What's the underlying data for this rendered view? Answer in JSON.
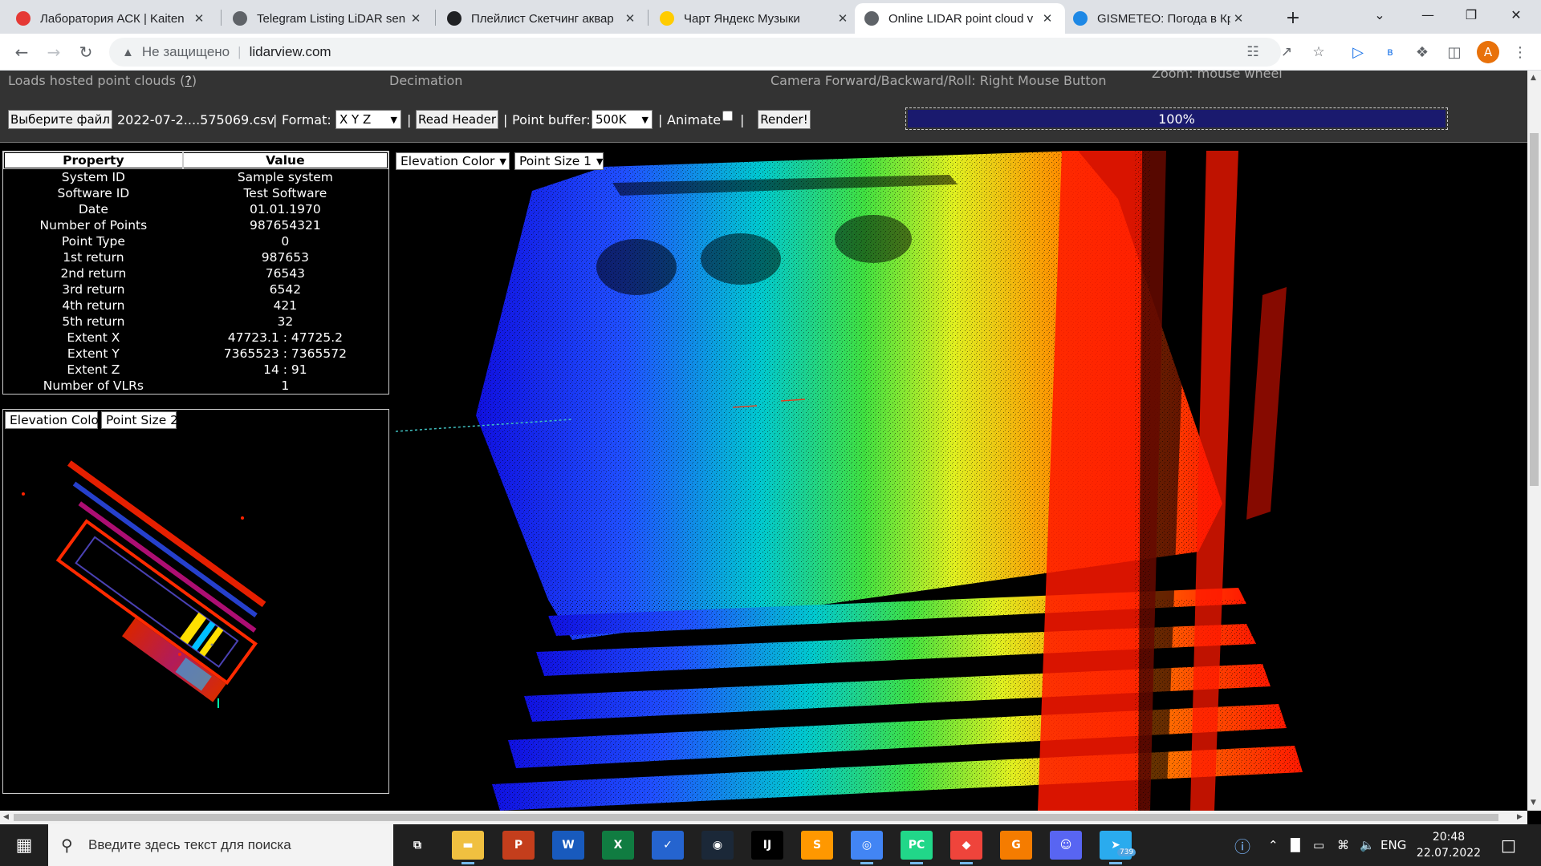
{
  "browser": {
    "tabs": [
      {
        "title": "Лаборатория АСК | Kaiten",
        "favicon": "kaiten-icon",
        "color": "#e53935",
        "active": false
      },
      {
        "title": "Telegram Listing LiDAR sen",
        "favicon": "globe-icon",
        "color": "#5f6368",
        "active": false
      },
      {
        "title": "Плейлист Скетчинг аквар",
        "favicon": "pause-icon",
        "color": "#202124",
        "active": false
      },
      {
        "title": "Чарт Яндекс Музыки",
        "favicon": "yandex-music-icon",
        "color": "#ffcc00",
        "active": false
      },
      {
        "title": "Online LIDAR point cloud v",
        "favicon": "globe-icon",
        "color": "#5f6368",
        "active": true
      },
      {
        "title": "GISMETEO: Погода в Крас",
        "favicon": "gismeteo-icon",
        "color": "#1e88e5",
        "active": false
      }
    ],
    "new_tab": "+",
    "address": {
      "security_label": "Не защищено",
      "url": "lidarview.com"
    },
    "profile_initial": "A",
    "extension_label": "в"
  },
  "page": {
    "help": {
      "loads_text": "Loads hosted point clouds (",
      "loads_link": "?",
      "loads_close": ")",
      "decimation": "Decimation",
      "camera": "Camera Forward/Backward/Roll: Right Mouse Button",
      "zoom": "Zoom: mouse wheel"
    },
    "controls": {
      "choose_file": "Выберите файл",
      "file_name": "2022-07-2....575069.csv",
      "sep": "|",
      "format_label": "Format:",
      "format_value": "X Y Z",
      "read_header": "Read Header",
      "point_buffer_label": "Point buffer:",
      "point_buffer_value": "500K",
      "animate_label": "Animate",
      "animate_checked": false,
      "render": "Render!",
      "progress_text": "100%",
      "progress_value": 1.0
    },
    "header_table": {
      "columns": [
        "Property",
        "Value"
      ],
      "rows": [
        [
          "System ID",
          "Sample system"
        ],
        [
          "Software ID",
          "Test Software"
        ],
        [
          "Date",
          "01.01.1970"
        ],
        [
          "Number of Points",
          "987654321"
        ],
        [
          "Point Type",
          "0"
        ],
        [
          "1st return",
          "987653"
        ],
        [
          "2nd return",
          "76543"
        ],
        [
          "3rd return",
          "6542"
        ],
        [
          "4th return",
          "421"
        ],
        [
          "5th return",
          "32"
        ],
        [
          "Extent X",
          "47723.1 : 47725.2"
        ],
        [
          "Extent Y",
          "7365523 : 7365572"
        ],
        [
          "Extent Z",
          "14 : 91"
        ],
        [
          "Number of VLRs",
          "1"
        ]
      ]
    },
    "main_view": {
      "color_mode": "Elevation Color",
      "point_size": "Point Size 1"
    },
    "mini_view": {
      "color_mode": "Elevation Color",
      "point_size": "Point Size 2"
    }
  },
  "taskbar": {
    "search_placeholder": "Введите здесь текст для поиска",
    "apps": [
      {
        "name": "task-view-icon",
        "label": "⧉",
        "color": "#202020"
      },
      {
        "name": "file-explorer-icon",
        "label": "▬",
        "color": "#f0c040"
      },
      {
        "name": "powerpoint-icon",
        "label": "P",
        "color": "#c43e1c"
      },
      {
        "name": "word-icon",
        "label": "W",
        "color": "#185abd"
      },
      {
        "name": "excel-icon",
        "label": "X",
        "color": "#107c41"
      },
      {
        "name": "todo-icon",
        "label": "✓",
        "color": "#2564cf"
      },
      {
        "name": "steam-icon",
        "label": "◉",
        "color": "#1b2838"
      },
      {
        "name": "intellij-icon",
        "label": "IJ",
        "color": "#000000"
      },
      {
        "name": "sublime-icon",
        "label": "S",
        "color": "#ff9800"
      },
      {
        "name": "chrome-icon",
        "label": "◎",
        "color": "#4285f4"
      },
      {
        "name": "pycharm-icon",
        "label": "PC",
        "color": "#21d789"
      },
      {
        "name": "anydesk-icon",
        "label": "◆",
        "color": "#ef443b"
      },
      {
        "name": "pdf-editor-icon",
        "label": "G",
        "color": "#f57c00"
      },
      {
        "name": "discord-icon",
        "label": "☺",
        "color": "#5865f2"
      },
      {
        "name": "telegram-icon",
        "label": "➤",
        "color": "#2aabee"
      }
    ],
    "telegram_badge": "739",
    "language": "ENG",
    "time": "20:48",
    "date": "22.07.2022"
  }
}
